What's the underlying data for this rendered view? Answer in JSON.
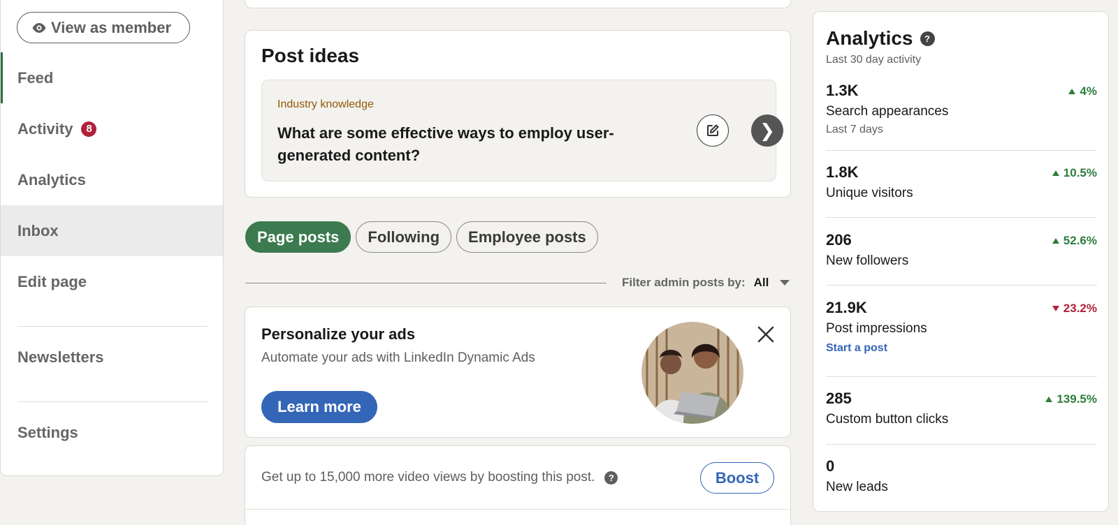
{
  "sidebar": {
    "view_as_member": "View as member",
    "items": [
      {
        "label": "Feed"
      },
      {
        "label": "Activity",
        "badge": "8"
      },
      {
        "label": "Analytics"
      },
      {
        "label": "Inbox"
      },
      {
        "label": "Edit page"
      },
      {
        "label": "Newsletters"
      },
      {
        "label": "Settings"
      }
    ]
  },
  "post_ideas": {
    "title": "Post ideas",
    "category": "Industry knowledge",
    "idea": "What are some effective ways to employ user-generated content?"
  },
  "tabs": [
    {
      "label": "Page posts"
    },
    {
      "label": "Following"
    },
    {
      "label": "Employee posts"
    }
  ],
  "filter": {
    "label": "Filter admin posts by:",
    "value": "All"
  },
  "ad_card": {
    "title": "Personalize your ads",
    "subtitle": "Automate your ads with LinkedIn Dynamic Ads",
    "button": "Learn more"
  },
  "boost": {
    "text": "Get up to 15,000 more video views by boosting this post.",
    "help": "?",
    "button": "Boost"
  },
  "analytics": {
    "title": "Analytics",
    "help": "?",
    "subtitle": "Last 30 day activity",
    "metrics": [
      {
        "value": "1.3K",
        "label": "Search appearances",
        "extra": "Last 7 days",
        "change": "4%",
        "direction": "up"
      },
      {
        "value": "1.8K",
        "label": "Unique visitors",
        "change": "10.5%",
        "direction": "up"
      },
      {
        "value": "206",
        "label": "New followers",
        "change": "52.6%",
        "direction": "up"
      },
      {
        "value": "21.9K",
        "label": "Post impressions",
        "link": "Start a post",
        "change": "23.2%",
        "direction": "down"
      },
      {
        "value": "285",
        "label": "Custom button clicks",
        "change": "139.5%",
        "direction": "up"
      },
      {
        "value": "0",
        "label": "New leads"
      }
    ]
  },
  "colors": {
    "brand_green": "#3c7a4f",
    "link_blue": "#3466b7",
    "up_green": "#2e7d3e",
    "down_red": "#b0213a",
    "badge_red": "#b0213a"
  },
  "icons": {
    "eye": "eye-icon",
    "edit": "edit-icon",
    "next": "chevron-right-icon",
    "close": "close-icon",
    "help": "help-icon",
    "caret": "caret-down-icon"
  }
}
